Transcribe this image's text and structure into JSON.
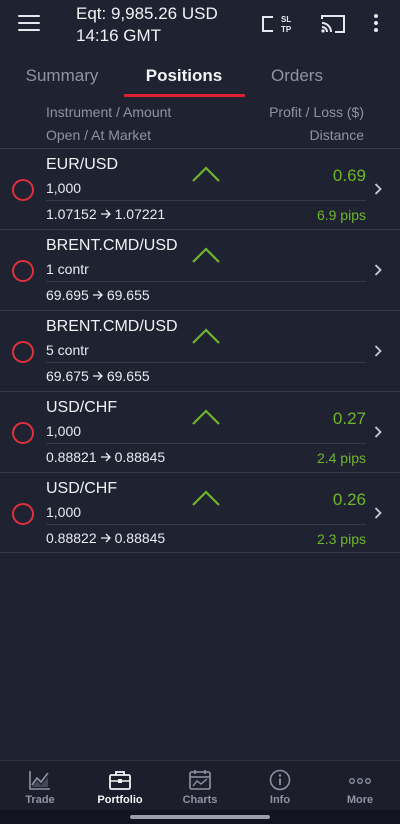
{
  "header": {
    "equity": "Eqt: 9,985.26 USD",
    "time": "14:16 GMT",
    "sltp_top": "SL",
    "sltp_bottom": "TP"
  },
  "tabs": [
    {
      "label": "Summary",
      "active": false
    },
    {
      "label": "Positions",
      "active": true
    },
    {
      "label": "Orders",
      "active": false
    }
  ],
  "columns": {
    "instrument_amount": "Instrument / Amount",
    "open_at_market": "Open / At Market",
    "profit_loss": "Profit / Loss ($)",
    "distance": "Distance"
  },
  "positions": [
    {
      "instrument": "EUR/USD",
      "amount": "1,000",
      "open": "1.07152",
      "market": "1.07221",
      "pl": "0.69",
      "distance": "6.9 pips"
    },
    {
      "instrument": "BRENT.CMD/USD",
      "amount": "1 contr",
      "open": "69.695",
      "market": "69.655",
      "pl": "",
      "distance": ""
    },
    {
      "instrument": "BRENT.CMD/USD",
      "amount": "5 contr",
      "open": "69.675",
      "market": "69.655",
      "pl": "",
      "distance": ""
    },
    {
      "instrument": "USD/CHF",
      "amount": "1,000",
      "open": "0.88821",
      "market": "0.88845",
      "pl": "0.27",
      "distance": "2.4 pips"
    },
    {
      "instrument": "USD/CHF",
      "amount": "1,000",
      "open": "0.88822",
      "market": "0.88845",
      "pl": "0.26",
      "distance": "2.3 pips"
    }
  ],
  "bottom_nav": [
    {
      "label": "Trade",
      "icon": "trade-chart-icon",
      "active": false
    },
    {
      "label": "Portfolio",
      "icon": "briefcase-icon",
      "active": true
    },
    {
      "label": "Charts",
      "icon": "calendar-chart-icon",
      "active": false
    },
    {
      "label": "Info",
      "icon": "info-icon",
      "active": false
    },
    {
      "label": "More",
      "icon": "more-dots-icon",
      "active": false
    }
  ],
  "colors": {
    "background": "#1f2230",
    "accent_red": "#e0212f",
    "profit_green": "#6fb62b",
    "muted_text": "#8f93a3"
  }
}
